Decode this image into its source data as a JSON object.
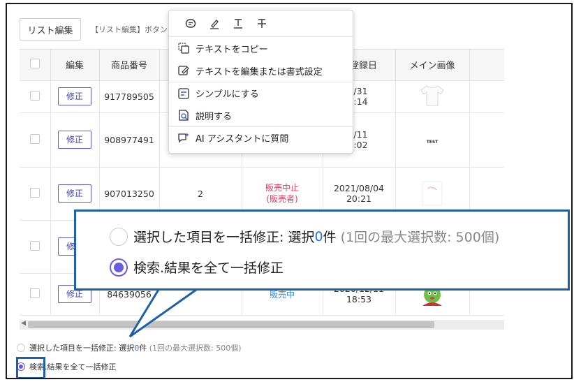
{
  "toolbar": {
    "edit_list_label": "リスト編集",
    "hint_text": "【リスト編集】ボタンよ"
  },
  "table": {
    "headers": [
      "",
      "編集",
      "商品番号",
      "",
      "",
      "品登録日",
      "メイン画像",
      ""
    ],
    "fix_label": "修正",
    "rows": [
      {
        "id": "917789505",
        "qty": "",
        "status": "",
        "date": "08/31 10:14",
        "image": "tshirt"
      },
      {
        "id": "908977491",
        "qty": "",
        "status": "",
        "date": "08/11 00:02",
        "image": "test"
      },
      {
        "id": "907013250",
        "qty": "2",
        "status": "販売中止\n(販売者)",
        "date": "2021/08/04 20:21",
        "image": "sketch"
      },
      {
        "id": "",
        "qty": "",
        "status": "",
        "date": "",
        "image": ""
      },
      {
        "id": "84639056",
        "qty": "",
        "status": "販売中",
        "date": "2020/12/11 18:53",
        "image": "mascot"
      }
    ],
    "test_label": "TEST"
  },
  "bulk": {
    "selected_label": "選択した項目を一括修正: 選択",
    "selected_count": "0",
    "selected_unit": "件",
    "max_note": "(1回の最大選択数: 500個)",
    "all_label": "検索.結果を全て一括修正"
  },
  "context_menu": {
    "items": [
      {
        "label": "テキストをコピー",
        "icon": "copy-icon"
      },
      {
        "label": "テキストを編集または書式設定",
        "icon": "edit-icon"
      },
      {
        "label": "シンプルにする",
        "icon": "simplify-icon"
      },
      {
        "label": "説明する",
        "icon": "explain-icon"
      },
      {
        "label": "AI アシスタントに質問",
        "icon": "ai-assistant-icon"
      }
    ],
    "toolbar_icons": [
      "comment-icon",
      "highlighter-icon",
      "underline-icon",
      "strikethrough-icon"
    ]
  },
  "colors": {
    "accent_purple": "#6a5ce0",
    "callout_blue": "#1f5fa8",
    "status_stop": "#e8385a",
    "status_sale": "#2b8be8"
  }
}
